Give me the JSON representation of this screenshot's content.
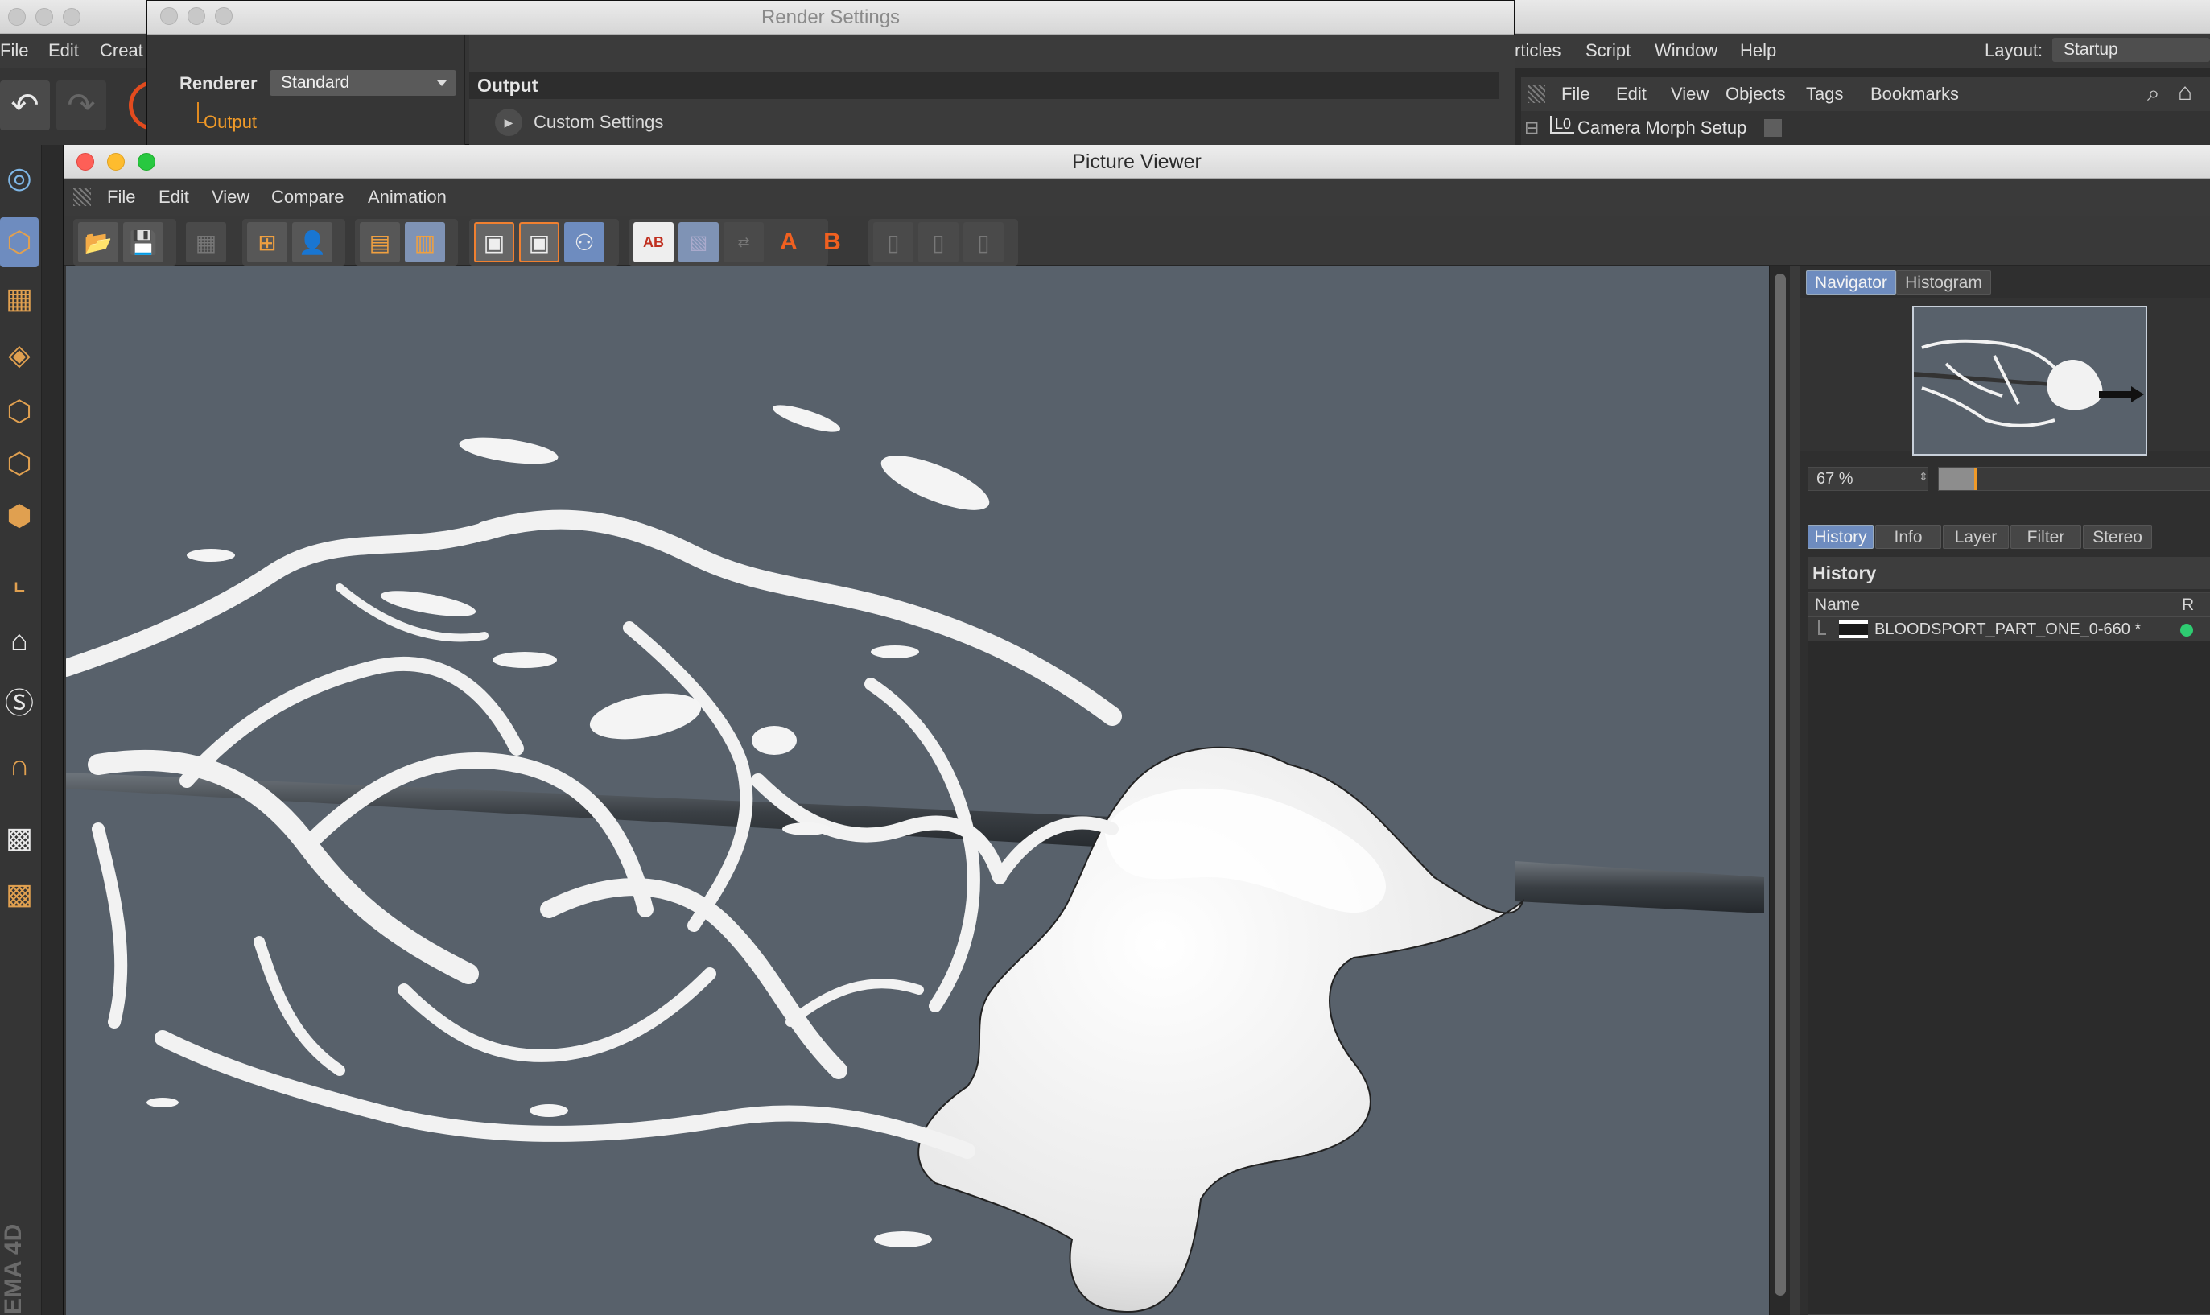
{
  "main_window": {
    "menu": [
      "File",
      "Edit",
      "Creat"
    ],
    "right_menu": [
      "rticles",
      "Script",
      "Window",
      "Help"
    ],
    "layout_label": "Layout:",
    "layout_value": "Startup",
    "object_manager": {
      "menu": [
        "File",
        "Edit",
        "View",
        "Objects",
        "Tags",
        "Bookmarks"
      ],
      "object_name": "Camera Morph Setup",
      "object_badge": "L0"
    },
    "logo_text": "EMA 4D"
  },
  "render_settings": {
    "title": "Render Settings",
    "renderer_label": "Renderer",
    "renderer_value": "Standard",
    "tree_item": "Output",
    "section_header": "Output",
    "custom_settings": "Custom Settings"
  },
  "picture_viewer": {
    "title": "Picture Viewer",
    "menu": [
      "File",
      "Edit",
      "View",
      "Compare",
      "Animation"
    ],
    "right_tabs": [
      {
        "label": "Navigator",
        "active": true
      },
      {
        "label": "Histogram",
        "active": false
      }
    ],
    "zoom": "67 %",
    "zoom_fraction": 0.13,
    "bottom_tabs": [
      {
        "label": "History",
        "active": true
      },
      {
        "label": "Info",
        "active": false
      },
      {
        "label": "Layer",
        "active": false
      },
      {
        "label": "Filter",
        "active": false
      },
      {
        "label": "Stereo",
        "active": false
      }
    ],
    "history_title": "History",
    "columns": {
      "name": "Name",
      "r": "R"
    },
    "history_item": "BLOODSPORT_PART_ONE_0-660 *",
    "status_color": "#2ecc71",
    "tool_b_label": "B",
    "tool_a_label": "A",
    "ab_label": "AB"
  },
  "colors": {
    "viewport_bg": "#58616b",
    "accent_orange": "#f09a28",
    "active_tab": "#6e8cbf"
  }
}
